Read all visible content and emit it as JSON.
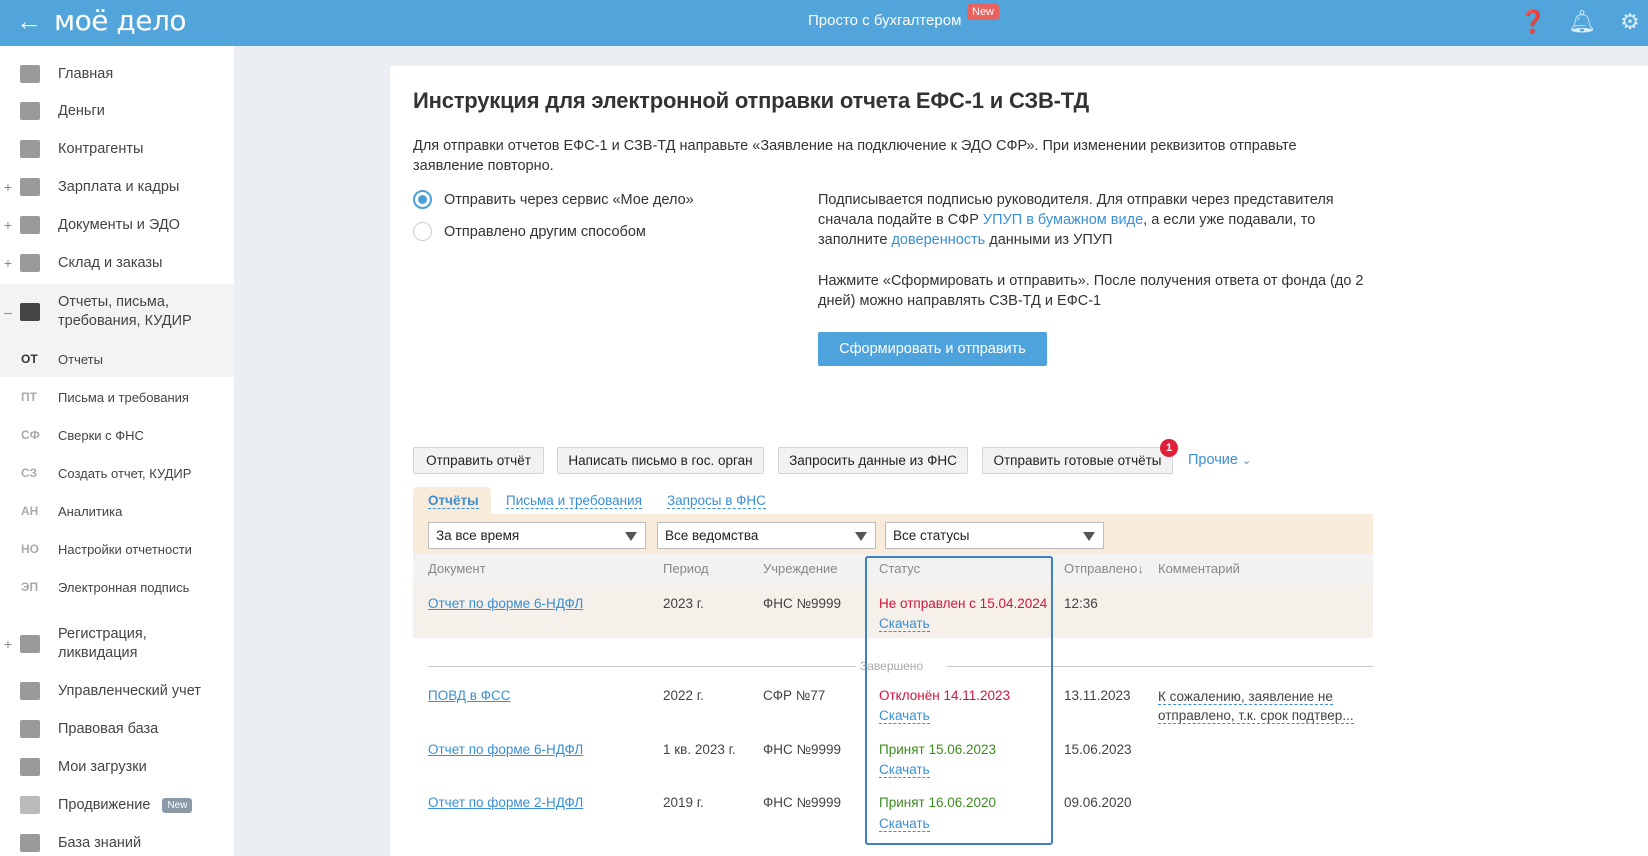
{
  "header": {
    "logo": "моё дело",
    "center_title": "Просто с бухгалтером",
    "new_badge": "New"
  },
  "sidebar": {
    "items": [
      {
        "label": "Главная",
        "icon": "home-icon"
      },
      {
        "label": "Деньги",
        "icon": "money-icon"
      },
      {
        "label": "Контрагенты",
        "icon": "contractor-icon"
      },
      {
        "label": "Зарплата и кадры",
        "icon": "wallet-icon",
        "expand": "+"
      },
      {
        "label": "Документы и ЭДО",
        "icon": "folder-icon",
        "expand": "+"
      },
      {
        "label": "Склад и заказы",
        "icon": "warehouse-icon",
        "expand": "+"
      },
      {
        "label": "Отчеты, письма, требования, КУДИР",
        "icon": "report-icon",
        "expand": "–"
      },
      {
        "label": "Регистрация, ликвидация",
        "icon": "registration-icon",
        "expand": "+"
      },
      {
        "label": "Управленческий учет",
        "icon": "ruble-icon"
      },
      {
        "label": "Правовая база",
        "icon": "briefcase-icon"
      },
      {
        "label": "Мои загрузки",
        "icon": "folder-icon"
      },
      {
        "label": "Продвижение",
        "icon": "chart-icon",
        "badge": "New"
      },
      {
        "label": "База знаний",
        "icon": "graduation-icon"
      }
    ],
    "subitems": [
      {
        "abbr": "ОТ",
        "label": "Отчеты"
      },
      {
        "abbr": "ПТ",
        "label": "Письма и требования"
      },
      {
        "abbr": "СФ",
        "label": "Сверки с ФНС"
      },
      {
        "abbr": "СЗ",
        "label": "Создать отчет, КУДИР"
      },
      {
        "abbr": "АН",
        "label": "Аналитика"
      },
      {
        "abbr": "НО",
        "label": "Настройки отчетности"
      },
      {
        "abbr": "ЭП",
        "label": "Электронная подпись"
      }
    ]
  },
  "main": {
    "title": "Инструкция для электронной отправки отчета ЕФС-1 и СЗВ-ТД",
    "intro": "Для отправки отчетов ЕФС-1 и СЗВ-ТД направьте «Заявление на подключение к ЭДО СФР». При изменении реквизитов отправьте заявление повторно.",
    "radio1": "Отправить через сервис «Мое дело»",
    "radio2": "Отправлено другим способом",
    "info1_a": "Подписывается подписью руководителя. Для отправки через представителя сначала подайте в СФР ",
    "info1_link1": "УПУП в бумажном виде",
    "info1_b": ", а если уже подавали, то заполните ",
    "info1_link2": "доверенность",
    "info1_c": " данными из УПУП",
    "info2": "Нажмите «Сформировать и отправить». После получения ответа от фонда (до 2 дней) можно направлять СЗВ-ТД и ЕФС-1",
    "primary_button": "Сформировать и отправить",
    "actions": [
      "Отправить отчёт",
      "Написать письмо в гос. орган",
      "Запросить данные из ФНС",
      "Отправить готовые отчёты"
    ],
    "actions_badge": "1",
    "more": "Прочие",
    "tabs": [
      "Отчёты",
      "Письма и требования",
      "Запросы в ФНС"
    ],
    "filters": [
      "За все время",
      "Все ведомства",
      "Все статусы"
    ],
    "columns": [
      "Документ",
      "Период",
      "Учреждение",
      "Статус",
      "Отправлено↓",
      "Комментарий"
    ],
    "divider": "Завершено",
    "download": "Скачать",
    "rows": [
      {
        "doc": "Отчет по форме 6-НДФЛ",
        "period": "2023 г.",
        "org": "ФНС №9999",
        "status": "Не отправлен с 15.04.2024",
        "sent": "12:36",
        "comment": ""
      },
      {
        "doc": "ПОВД в ФСС",
        "period": "2022 г.",
        "org": "СФР №77",
        "status": "Отклонён 14.11.2023",
        "sent": "13.11.2023",
        "comment1": "К сожалению, заявление не",
        "comment2": "отправлено, т.к. срок подтвер..."
      },
      {
        "doc": "Отчет по форме 6-НДФЛ",
        "period": "1 кв. 2023 г.",
        "org": "ФНС №9999",
        "status": "Принят 15.06.2023",
        "sent": "15.06.2023",
        "comment": ""
      },
      {
        "doc": "Отчет по форме 2-НДФЛ",
        "period": "2019 г.",
        "org": "ФНС №9999",
        "status": "Принят 16.06.2020",
        "sent": "09.06.2020",
        "comment": ""
      }
    ]
  }
}
